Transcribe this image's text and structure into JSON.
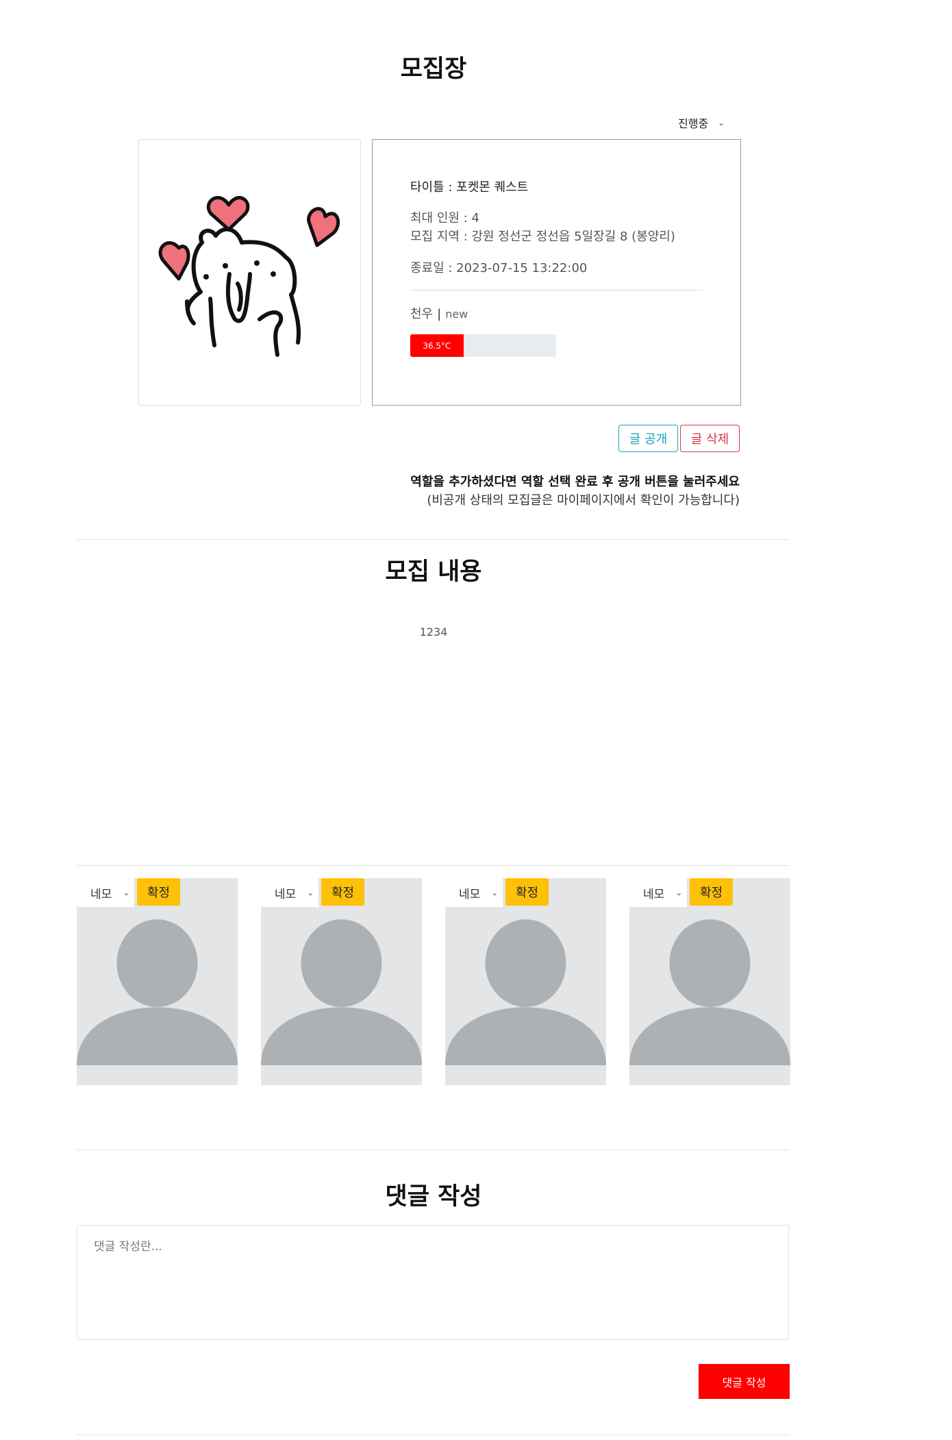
{
  "page": {
    "title": "모집장",
    "status_select": {
      "value": "진행중"
    },
    "info": {
      "title_line": "타이틀 : 포켓몬 퀘스트",
      "max_line": "최대 인원 : 4",
      "region_line": "모집 지역 : 강원 정선군 정선읍 5일장길 8 (봉양리)",
      "end_line": "종료일 : 2023-07-15 13:22:00",
      "user_name": "천우",
      "user_sep": "|",
      "user_badge": "new",
      "temperature_label": "36.5°C",
      "temperature_fraction": 0.365
    },
    "buttons": {
      "publish": "글 공개",
      "delete": "글 삭제"
    },
    "notice": {
      "line1": "역할을 추가하셨다면 역할 선택 완료 후 공개 버튼을 눌러주세요",
      "line2": "(비공개 상태의 모집글은 마이페이지에서 확인이 가능합니다)"
    }
  },
  "content": {
    "title": "모집 내용",
    "body": "1234"
  },
  "roles": [
    {
      "role": "네모",
      "confirm": "확정"
    },
    {
      "role": "네모",
      "confirm": "확정"
    },
    {
      "role": "네모",
      "confirm": "확정"
    },
    {
      "role": "네모",
      "confirm": "확정"
    }
  ],
  "comment": {
    "title": "댓글 작성",
    "placeholder": "댓글 작성란...",
    "submit": "댓글 작성"
  },
  "colors": {
    "temperature": "#ff0000",
    "confirm": "#ffc107",
    "publish": "#17a2b8",
    "delete": "#dc3545",
    "submit": "#ff0000"
  },
  "icons": {
    "image": "cat-with-hearts-illustration",
    "avatar": "person-placeholder-icon",
    "dropdown": "chevron-down-icon"
  }
}
